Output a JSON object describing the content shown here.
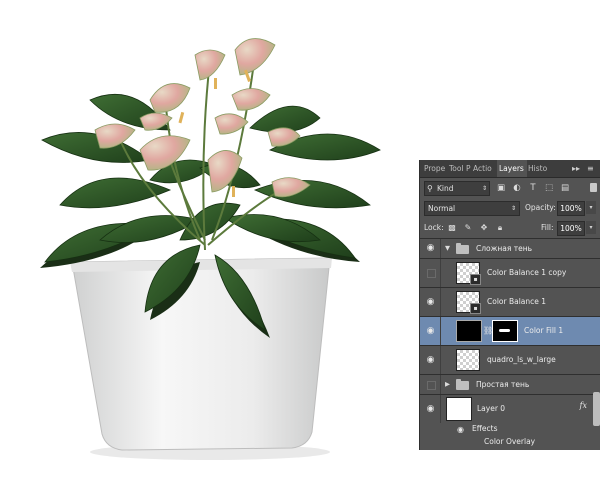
{
  "panel": {
    "tabs": [
      "Prope",
      "Tool P",
      "Actio",
      "Layers",
      "Histo"
    ],
    "tab_menu_icons": [
      "collapse-icon",
      "panel-menu-icon"
    ],
    "filter": {
      "kind_label": "Kind"
    },
    "blend_mode": "Normal",
    "opacity_label": "Opacity:",
    "opacity_value": "100%",
    "lock_label": "Lock:",
    "fill_label": "Fill:",
    "fill_value": "100%"
  },
  "layers": [
    {
      "name": "Сложная тень",
      "type": "group",
      "visible": true,
      "expanded": true
    },
    {
      "name": "Color Balance 1 copy",
      "type": "smart-object",
      "visible": false
    },
    {
      "name": "Color Balance 1",
      "type": "smart-object",
      "visible": true
    },
    {
      "name": "Color Fill 1",
      "type": "fill-with-mask",
      "visible": true,
      "selected": true
    },
    {
      "name": "quadro_ls_w_large",
      "type": "pixel",
      "visible": true
    },
    {
      "name": "Простая тень",
      "type": "group",
      "visible": false,
      "expanded": false
    },
    {
      "name": "Layer 0",
      "type": "pixel",
      "visible": true,
      "fx": "fx"
    }
  ],
  "effects": {
    "label": "Effects",
    "items": [
      "Color Overlay"
    ]
  },
  "colors": {
    "panel_bg": "#535353",
    "selected_layer": "#6e8ab0",
    "leaf_green": "#2f5a26",
    "pot_white": "#f2f2f2"
  }
}
